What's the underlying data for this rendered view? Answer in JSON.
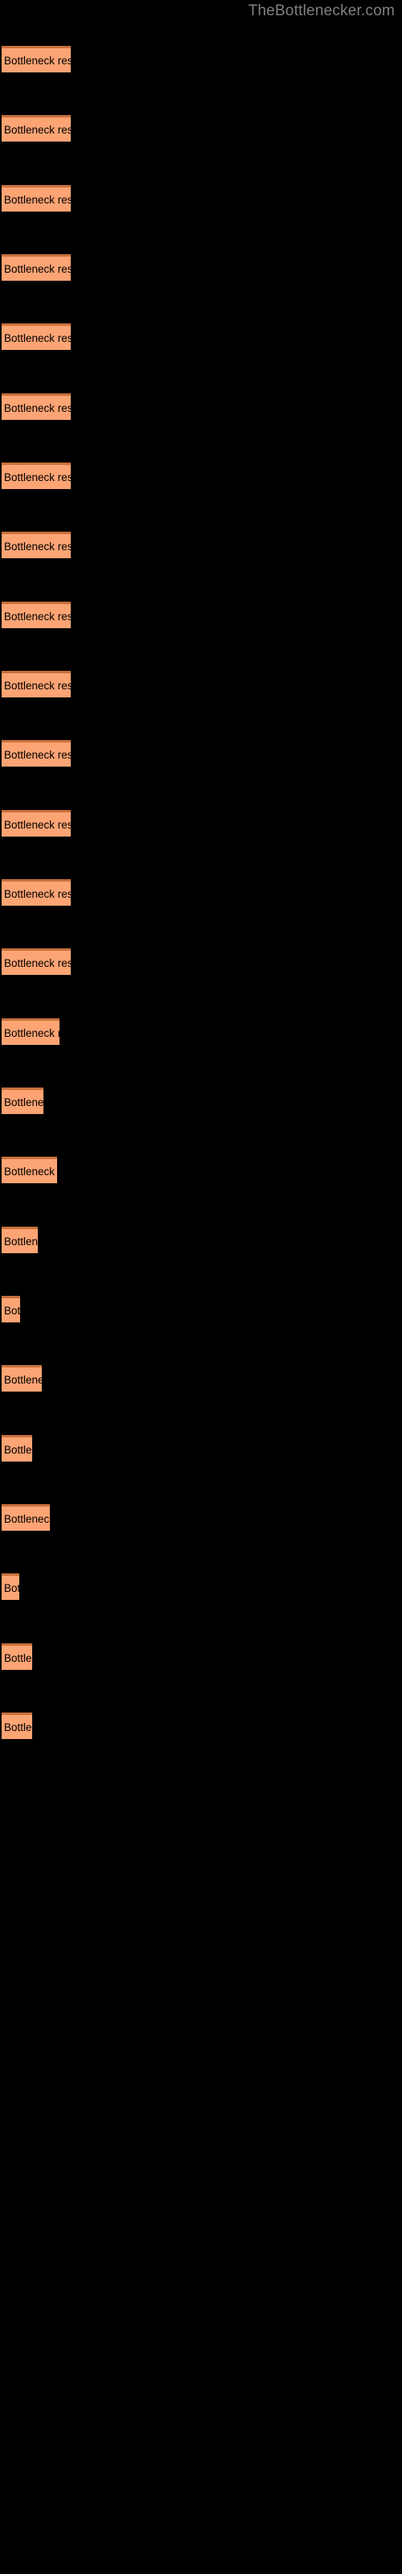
{
  "site": {
    "title": "TheBottlenecker.com",
    "title_color": "#808080",
    "background_color": "#000000"
  },
  "chart_data": {
    "type": "bar",
    "orientation": "horizontal",
    "title": "TheBottlenecker.com",
    "subtitle": "",
    "xlabel": "",
    "ylabel": "",
    "grid": false,
    "legend": null,
    "bar_color": "#FCA474",
    "bar_border_color": "#C8703C",
    "label_color": "#000000",
    "bar_label_text": "Bottleneck result",
    "xlim": [
      0,
      500
    ],
    "axis_visible": false,
    "tick_labels": [],
    "categories": [
      "Bottleneck result",
      "Bottleneck result",
      "Bottleneck result",
      "Bottleneck result",
      "Bottleneck result",
      "Bottleneck result",
      "Bottleneck result",
      "Bottleneck result",
      "Bottleneck result",
      "Bottleneck result",
      "Bottleneck result",
      "Bottleneck result",
      "Bottleneck result",
      "Bottleneck result",
      "Bottleneck result",
      "Bottleneck result",
      "Bottleneck result",
      "Bottleneck result",
      "Bottleneck result",
      "Bottleneck result",
      "Bottleneck result",
      "Bottleneck result",
      "Bottleneck result",
      "Bottleneck result",
      "Bottleneck result"
    ],
    "values": [
      86,
      86,
      86,
      86,
      86,
      86,
      86,
      86,
      86,
      86,
      86,
      86,
      86,
      86,
      72,
      52,
      69,
      45,
      23,
      50,
      38,
      60,
      22,
      38,
      38
    ]
  },
  "bars": [
    {
      "index": 1,
      "label": "Bottleneck result",
      "width": 86,
      "top": 57
    },
    {
      "index": 2,
      "label": "Bottleneck result",
      "width": 86,
      "top": 143
    },
    {
      "index": 3,
      "label": "Bottleneck result",
      "width": 86,
      "top": 230
    },
    {
      "index": 4,
      "label": "Bottleneck result",
      "width": 86,
      "top": 316
    },
    {
      "index": 5,
      "label": "Bottleneck result",
      "width": 86,
      "top": 402
    },
    {
      "index": 6,
      "label": "Bottleneck result",
      "width": 86,
      "top": 489
    },
    {
      "index": 7,
      "label": "Bottleneck result",
      "width": 86,
      "top": 575
    },
    {
      "index": 8,
      "label": "Bottleneck result",
      "width": 86,
      "top": 661
    },
    {
      "index": 9,
      "label": "Bottleneck result",
      "width": 86,
      "top": 748
    },
    {
      "index": 10,
      "label": "Bottleneck result",
      "width": 86,
      "top": 834
    },
    {
      "index": 11,
      "label": "Bottleneck result",
      "width": 86,
      "top": 920
    },
    {
      "index": 12,
      "label": "Bottleneck result",
      "width": 86,
      "top": 1007
    },
    {
      "index": 13,
      "label": "Bottleneck result",
      "width": 86,
      "top": 1093
    },
    {
      "index": 14,
      "label": "Bottleneck result",
      "width": 86,
      "top": 1179
    },
    {
      "index": 15,
      "label": "Bottleneck result",
      "width": 72,
      "top": 1266
    },
    {
      "index": 16,
      "label": "Bottleneck result",
      "width": 52,
      "top": 1352
    },
    {
      "index": 17,
      "label": "Bottleneck result",
      "width": 69,
      "top": 1438
    },
    {
      "index": 18,
      "label": "Bottleneck result",
      "width": 45,
      "top": 1525
    },
    {
      "index": 19,
      "label": "Bottleneck result",
      "width": 23,
      "top": 1611
    },
    {
      "index": 20,
      "label": "Bottleneck result",
      "width": 50,
      "top": 1697
    },
    {
      "index": 21,
      "label": "Bottleneck result",
      "width": 38,
      "top": 1784
    },
    {
      "index": 22,
      "label": "Bottleneck result",
      "width": 60,
      "top": 1870
    },
    {
      "index": 23,
      "label": "Bottleneck result",
      "width": 22,
      "top": 1956
    },
    {
      "index": 24,
      "label": "Bottleneck result",
      "width": 38,
      "top": 2043
    },
    {
      "index": 25,
      "label": "Bottleneck result",
      "width": 38,
      "top": 2129
    }
  ]
}
